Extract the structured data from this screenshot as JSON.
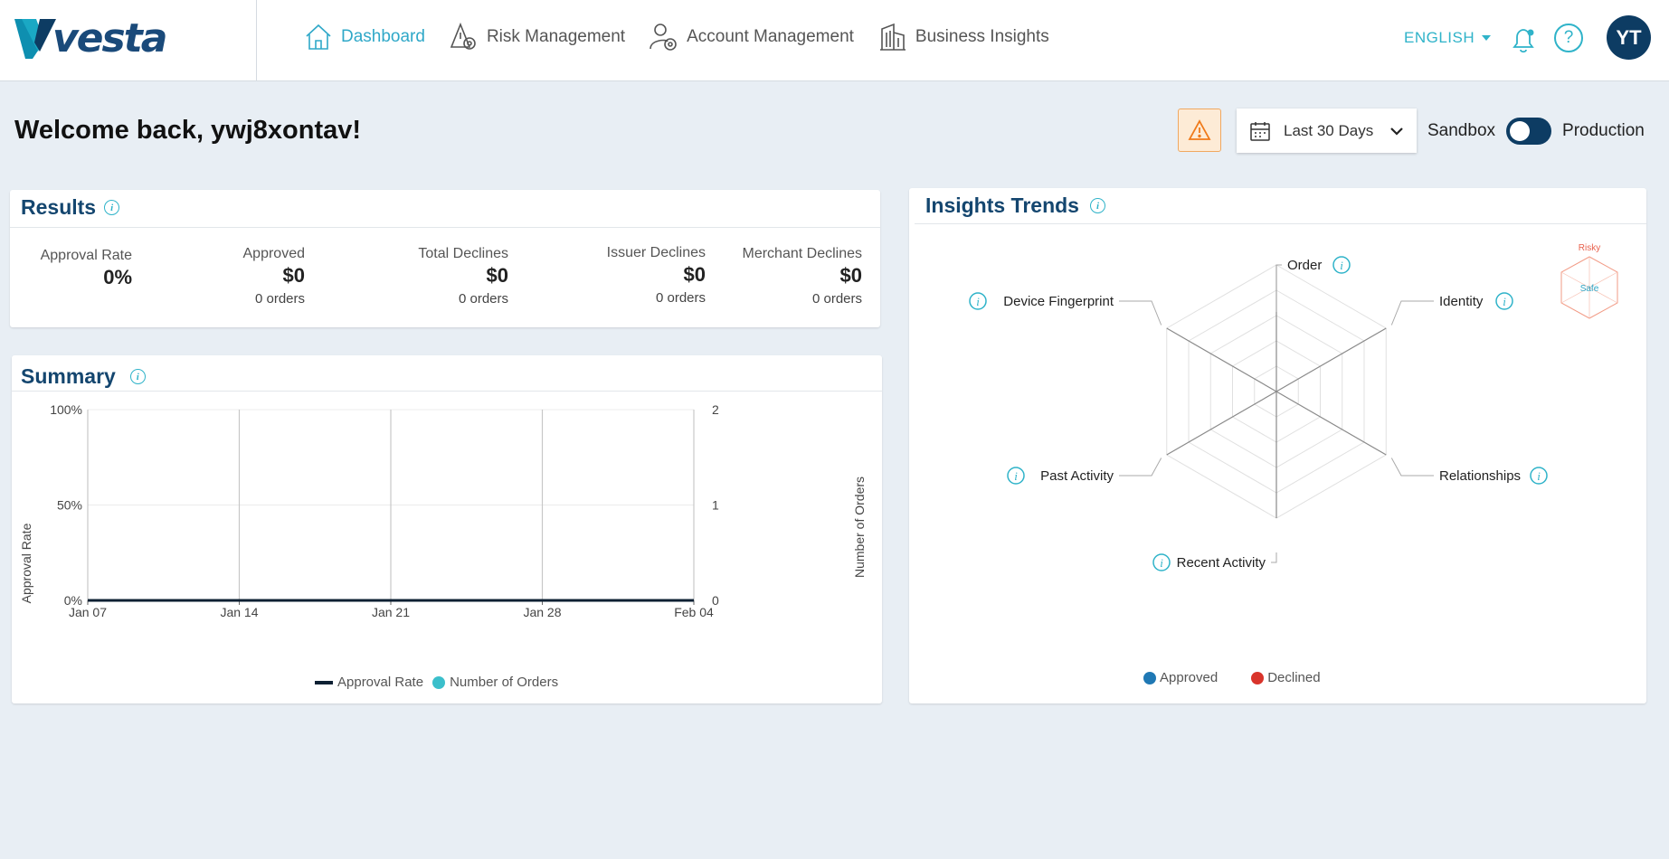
{
  "header": {
    "logo_text": "vesta",
    "nav": [
      {
        "label": "Dashboard",
        "icon": "home-icon",
        "active": true
      },
      {
        "label": "Risk Management",
        "icon": "shield-gear-icon",
        "active": false
      },
      {
        "label": "Account Management",
        "icon": "user-gear-icon",
        "active": false
      },
      {
        "label": "Business Insights",
        "icon": "building-icon",
        "active": false
      }
    ],
    "language": "ENGLISH",
    "help_symbol": "?",
    "avatar_initials": "YT"
  },
  "toolbar": {
    "welcome": "Welcome back, ywj8xontav!",
    "date_range": "Last 30 Days",
    "env_left": "Sandbox",
    "env_right": "Production"
  },
  "results": {
    "title": "Results",
    "metrics": [
      {
        "label": "Approval Rate",
        "value": "0%",
        "orders": ""
      },
      {
        "label": "Approved",
        "value": "$0",
        "orders": "0 orders"
      },
      {
        "label": "Total Declines",
        "value": "$0",
        "orders": "0 orders"
      },
      {
        "label": "Issuer Declines",
        "value": "$0",
        "orders": "0 orders"
      },
      {
        "label": "Merchant Declines",
        "value": "$0",
        "orders": "0 orders"
      }
    ]
  },
  "summary": {
    "title": "Summary",
    "legend": [
      "Approval Rate",
      "Number of Orders"
    ]
  },
  "insights": {
    "title": "Insights Trends",
    "badge_top": "Risky",
    "badge_center": "Safe",
    "axes": [
      "Order",
      "Identity",
      "Relationships",
      "Recent Activity",
      "Past Activity",
      "Device Fingerprint"
    ],
    "legend": [
      "Approved",
      "Declined"
    ]
  },
  "colors": {
    "brand_dark": "#0d3c63",
    "accent": "#2fb3c9",
    "approved": "#1f78b4",
    "declined": "#d9342b"
  },
  "chart_data": [
    {
      "type": "line",
      "x": [
        "Jan 07",
        "Jan 14",
        "Jan 21",
        "Jan 28",
        "Feb 04"
      ],
      "series": [
        {
          "name": "Approval Rate",
          "values": [
            0,
            0,
            0,
            0,
            0
          ]
        },
        {
          "name": "Number of Orders",
          "values": [
            0,
            0,
            0,
            0,
            0
          ]
        }
      ],
      "ylabel": "Approval Rate",
      "y2label": "Number of Orders",
      "yticks": [
        "0%",
        "50%",
        "100%"
      ],
      "y2ticks": [
        "0",
        "1",
        "2"
      ],
      "ylim": [
        0,
        100
      ],
      "y2lim": [
        0,
        2
      ]
    },
    {
      "type": "radar",
      "axes": [
        "Order",
        "Identity",
        "Relationships",
        "Recent Activity",
        "Past Activity",
        "Device Fingerprint"
      ],
      "series": [
        {
          "name": "Approved",
          "values": [
            0,
            0,
            0,
            0,
            0,
            0
          ]
        },
        {
          "name": "Declined",
          "values": [
            0,
            0,
            0,
            0,
            0,
            0
          ]
        }
      ]
    }
  ]
}
